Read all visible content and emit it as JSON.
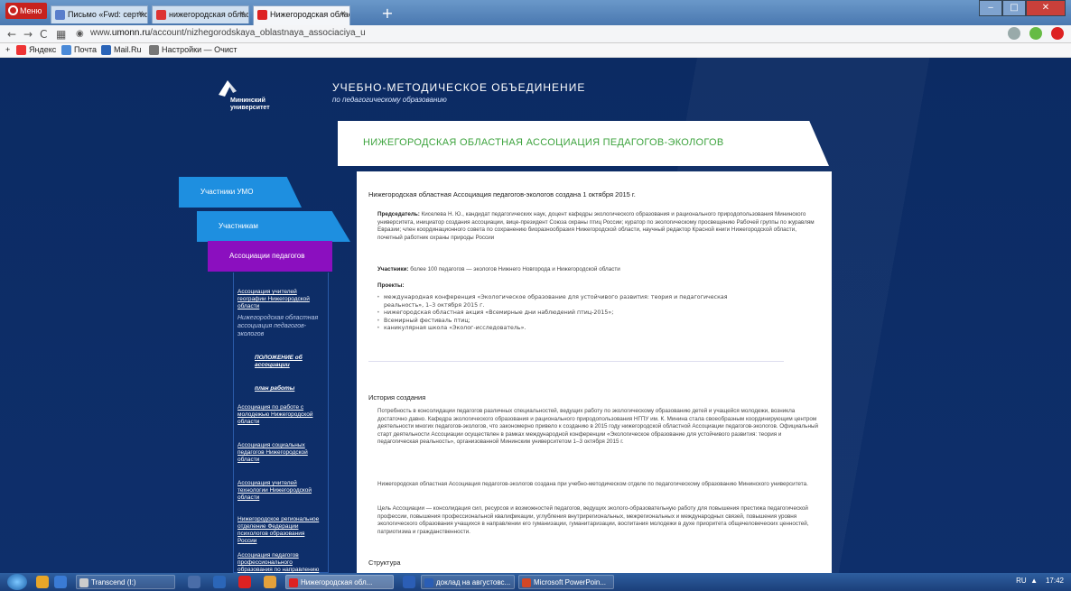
{
  "browser": {
    "menu_label": "Меню",
    "tabs": [
      {
        "label": "Письмо «Fwd: сертифика",
        "color": "#5a7ecb"
      },
      {
        "label": "нижегородская областна",
        "color": "#d33"
      },
      {
        "label": "Нижегородская областна",
        "color": "#d22"
      }
    ],
    "new_tab": "+",
    "url_prefix": "www.",
    "url_host": "umonn.ru",
    "url_path": "/account/nizhegorodskaya_oblastnaya_associaciya_u",
    "bookmarks": [
      {
        "label": "Яндекс",
        "color": "#e33"
      },
      {
        "label": "Почта",
        "color": "#4a8ad8"
      },
      {
        "label": "Mail.Ru",
        "color": "#2a64b8"
      },
      {
        "label": "Настройки — Очист",
        "color": "#777"
      }
    ]
  },
  "site": {
    "logo_line1": "Мининский",
    "logo_line2": "университет",
    "title": "УЧЕБНО-МЕТОДИЧЕСКОЕ ОБЪЕДИНЕНИЕ",
    "subtitle": "по педагогическому образованию",
    "page_title": "НИЖЕГОРОДСКАЯ ОБЛАСТНАЯ АССОЦИАЦИЯ ПЕДАГОГОВ-ЭКОЛОГОВ"
  },
  "nav": {
    "umo": "Участники УМО",
    "members": "Участникам",
    "associations": "Ассоциации педагогов"
  },
  "subnav": {
    "geo": "Ассоциация учителей географии Нижегородской области",
    "eco": "Нижегородская областная ассоциация педагогов-экологов",
    "regulation": "ПОЛОЖЕНИЕ об ассоциации",
    "plan": "план работы",
    "youth": "Ассоциация по работе с молодежью Нижегородской области",
    "social": "Ассоциация социальных педагогов Нижегородской области",
    "tech": "Ассоциация учителей технологии Нижегородской области",
    "psych": "Нижегородское региональное отделение Федерации психологов образования России",
    "prof": "Ассоциация педагогов профессионального образования по направлению"
  },
  "content": {
    "lead": "Нижегородская областная Ассоциация педагогов-экологов создана 1 октября 2015 г.",
    "chair_label": "Председатель:",
    "chair_text": " Киселева Н. Ю., кандидат педагогических наук, доцент кафедры экологического образования и рационального природопользования Мининского университета, инициатор создания ассоциации, вице-президент Союза охраны птиц России; куратор по экологическому просвещению Рабочей группы по журавлям Евразии; член координационного совета по сохранению биоразнообразия Нижегородской области, научный редактор Красной книги Нижегородской области, почетный работник охраны природы России",
    "members_label": "Участники:",
    "members_text": " более 100 педагогов — экологов Нижнего Новгорода и Нижегородской области",
    "projects_label": "Проекты:",
    "projects": [
      "международная конференция «Экологическое образование для устойчивого развития: теория и педагогическая реальность», 1–3 октября 2015 г.",
      "нижегородская областная акция «Всемирные дни наблюдений птиц-2015»;",
      "Всемирный фестиваль птиц;",
      "каникулярная школа «Эколог-исследователь»."
    ],
    "history_title": "История создания",
    "history_p1": "Потребность в консолидации педагогов различных специальностей, ведущих работу по экологическому образованию детей и учащейся молодежи, возникла достаточно давно. Кафедра экологического образования и рационального природопользования НГПУ им. К. Минина стала своеобразным координирующим центром деятельности многих педагогов-экологов, что закономерно привело к созданию в 2015 году нижегородской областной Ассоциации педагогов-экологов. Официальный старт деятельности Ассоциации осуществлен в рамках международной конференции «Экологическое образование для устойчивого развития: теория и педагогическая реальность», организованной Мининским университетом 1–3 октября 2015 г.",
    "history_p2": "Нижегородская областная Ассоциация педагогов-экологов создана при учебно-методическом отделе по педагогическому образованию Мининского университета.",
    "history_p3": "Цель Ассоциации — консолидация сил, ресурсов и возможностей педагогов, ведущих эколого-образовательную работу для повышения престижа педагогической профессии, повышения профессиональной квалификации, углубления внутрирегиональных, межрегиональных и международных связей, повышения уровня экологического образования учащихся в направлении его гуманизации, гуманитаризации, воспитания молодежи в духе приоритета общечеловеческих ценностей, патриотизма и гражданственности.",
    "structure_title": "Структура"
  },
  "taskbar": {
    "items": [
      {
        "label": "Transcend (I:)",
        "color": "#ccc"
      },
      {
        "label": "Нижегородская обл...",
        "color": "#d22"
      },
      {
        "label": "доклад на августовс...",
        "color": "#2b5eb5"
      },
      {
        "label": "Microsoft PowerPoin...",
        "color": "#d24726"
      }
    ],
    "lang": "RU",
    "time": "17:42"
  }
}
